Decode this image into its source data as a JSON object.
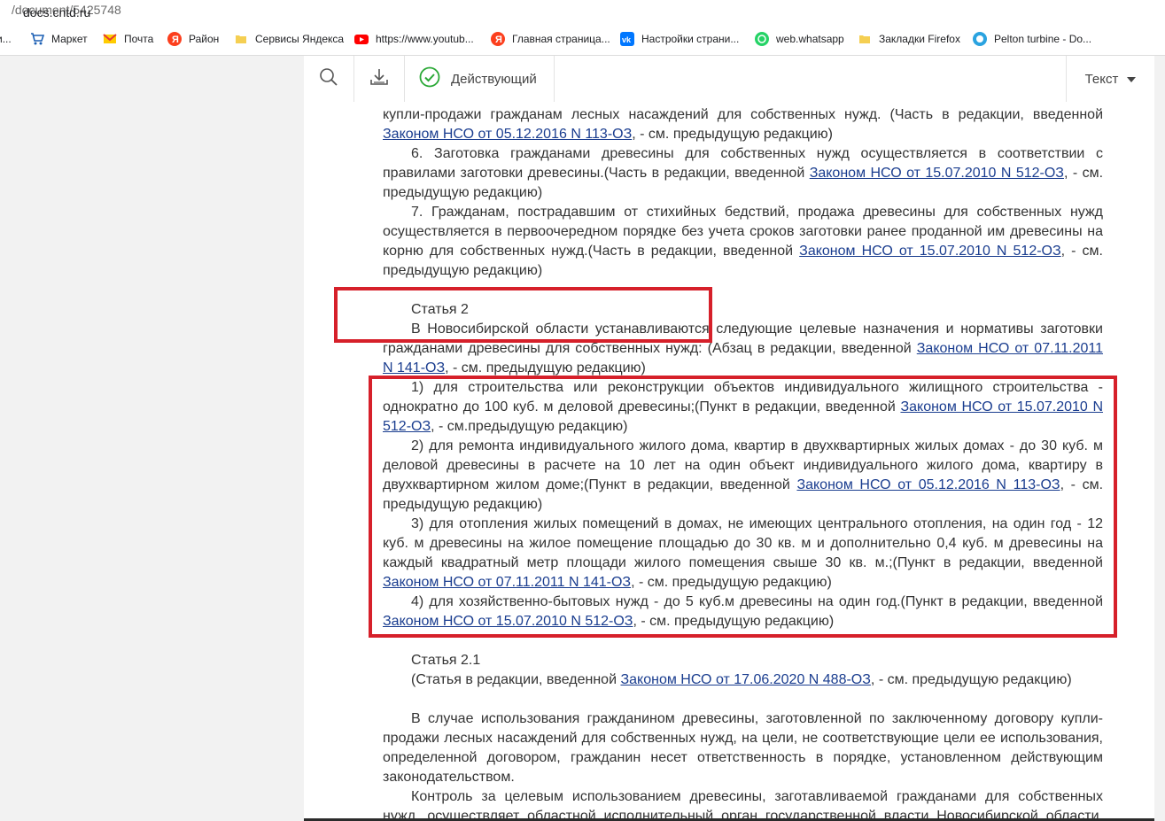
{
  "browser": {
    "url_host": "docs.cntd.ru",
    "url_path": "/document/5425748",
    "bookmarks": [
      "и...",
      "Маркет",
      "Почта",
      "Район",
      "Сервисы Яндекса",
      "https://www.youtub...",
      "Главная страница...",
      "Настройки страни...",
      "web.whatsapp",
      "Закладки Firefox",
      "Pelton turbine - Do..."
    ]
  },
  "toolbar": {
    "search_icon": "search-icon",
    "download_icon": "download-icon",
    "status_label": "Действующий",
    "status_color": "#2aa836",
    "view_select": "Текст"
  },
  "doc": {
    "lines": [
      {
        "segs": [
          "купли-продажи гражданам лесных насаждений для собственных нужд. (Часть в редакции, введенной"
        ],
        "cls": "j"
      },
      {
        "segs": [
          "",
          "Законом НСО от 05.12.2016 N 113-ОЗ",
          ", - см. предыдущую редакцию)"
        ],
        "cls": ""
      },
      {
        "segs": [
          "6. Заготовка гражданами древесины для собственных нужд осуществляется в соответствии с"
        ],
        "cls": "j ind"
      },
      {
        "segs": [
          "правилами заготовки древесины.(Часть в редакции, введенной ",
          "Законом НСО от 15.07.2010 N 512-ОЗ",
          ", - см."
        ],
        "cls": "j"
      },
      {
        "segs": [
          "предыдущую редакцию)"
        ],
        "cls": ""
      },
      {
        "segs": [
          "7. Гражданам, пострадавшим от стихийных бедствий, продажа древесины для собственных нужд"
        ],
        "cls": "j ind"
      },
      {
        "segs": [
          "осуществляется в первоочередном порядке без учета сроков заготовки ранее проданной им древесины на"
        ],
        "cls": "j"
      },
      {
        "segs": [
          "корню для собственных нужд.(Часть в редакции, введенной ",
          "Законом НСО от 15.07.2010 N 512-ОЗ",
          ", - см."
        ],
        "cls": "j"
      },
      {
        "segs": [
          "предыдущую редакцию)"
        ],
        "cls": ""
      },
      {
        "segs": [
          ""
        ],
        "cls": ""
      },
      {
        "segs": [
          "Статья 2"
        ],
        "cls": "ind"
      },
      {
        "segs": [
          "В Новосибирской области устанавливаются следующие целевые назначения и нормативы заготовки"
        ],
        "cls": "j ind"
      },
      {
        "segs": [
          "гражданами древесины для собственных нужд:  (Абзац в редакции, введенной ",
          "Законом НСО от 07.11.2011",
          ""
        ],
        "cls": "j"
      },
      {
        "segs": [
          "",
          "N 141-ОЗ",
          ", - см. предыдущую редакцию)"
        ],
        "cls": ""
      },
      {
        "segs": [
          "1) для строительства или реконструкции объектов индивидуального жилищного строительства -"
        ],
        "cls": "j ind"
      },
      {
        "segs": [
          "однократно до 100 куб. м  деловой древесины;(Пункт в редакции, введенной ",
          "Законом НСО от 15.07.2010 N",
          ""
        ],
        "cls": "j"
      },
      {
        "segs": [
          "",
          "512-ОЗ",
          ", - см.предыдущую редакцию)"
        ],
        "cls": ""
      },
      {
        "segs": [
          "2) для ремонта индивидуального жилого дома, квартир в двухквартирных жилых домах - до 30 куб. м"
        ],
        "cls": "j ind"
      },
      {
        "segs": [
          "деловой древесины в расчете на 10 лет на один объект индивидуального жилого дома, квартиру в"
        ],
        "cls": "j"
      },
      {
        "segs": [
          "двухквартирном жилом доме;(Пункт в редакции, введенной ",
          "Законом НСО от 05.12.2016 N 113-ОЗ",
          ", - см."
        ],
        "cls": "j"
      },
      {
        "segs": [
          "предыдущую редакцию)"
        ],
        "cls": ""
      },
      {
        "segs": [
          "3) для отопления жилых помещений в домах, не имеющих центрального отопления, на один год - 12"
        ],
        "cls": "j ind"
      },
      {
        "segs": [
          "куб. м древесины на жилое помещение площадью до 30 кв. м и дополнительно 0,4 куб. м древесины на"
        ],
        "cls": "j"
      },
      {
        "segs": [
          "каждый квадратный метр площади жилого помещения свыше 30 кв. м.;(Пункт в редакции, введенной"
        ],
        "cls": "j"
      },
      {
        "segs": [
          "",
          "Законом НСО от 07.11.2011 N 141-ОЗ",
          ", - см. предыдущую редакцию)"
        ],
        "cls": ""
      },
      {
        "segs": [
          "4) для хозяйственно-бытовых нужд - до 5 куб.м  древесины на один год.(Пункт в редакции, введенной"
        ],
        "cls": "j ind"
      },
      {
        "segs": [
          "",
          "Законом НСО от 15.07.2010 N 512-ОЗ",
          ", - см. предыдущую редакцию)"
        ],
        "cls": ""
      },
      {
        "segs": [
          ""
        ],
        "cls": ""
      },
      {
        "segs": [
          "Статья 2.1"
        ],
        "cls": "ind"
      },
      {
        "segs": [
          "(Статья  в редакции, введенной ",
          "Законом НСО от 17.06.2020 N 488-ОЗ",
          ", - см. предыдущую редакцию)"
        ],
        "cls": "ind"
      },
      {
        "segs": [
          ""
        ],
        "cls": ""
      },
      {
        "segs": [
          "В случае использования гражданином древесины, заготовленной по заключенному договору купли-"
        ],
        "cls": "j ind"
      },
      {
        "segs": [
          "продажи лесных насаждений для собственных нужд, на цели, не соответствующие цели  ее использования,"
        ],
        "cls": "j"
      },
      {
        "segs": [
          "определенной договором, гражданин несет ответственность в порядке, установленном действующим"
        ],
        "cls": "j"
      },
      {
        "segs": [
          "законодательством."
        ],
        "cls": ""
      },
      {
        "segs": [
          "Контроль за целевым использованием древесины, заготавливаемой гражданами для собственных"
        ],
        "cls": "j ind"
      },
      {
        "segs": [
          "нужд, осуществляет областной исполнительный орган государственной власти Новосибирской области,"
        ],
        "cls": "j"
      }
    ]
  }
}
